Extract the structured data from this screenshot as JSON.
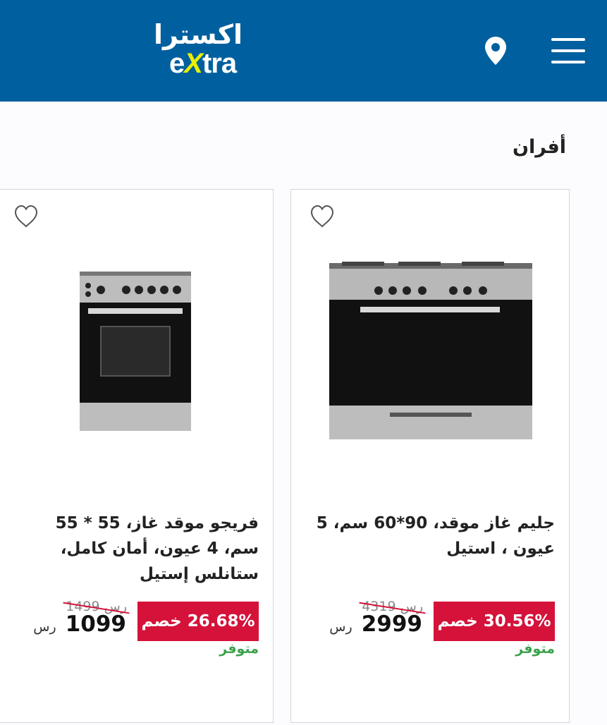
{
  "header": {
    "logo_ar": "اكسترا",
    "logo_en_pre": "e",
    "logo_en_x": "X",
    "logo_en_post": "tra",
    "brand_color": "#00609f",
    "accent_color": "#e8f000",
    "icons": [
      "location-pin-icon",
      "hamburger-menu-icon"
    ]
  },
  "section": {
    "title": "أفران"
  },
  "products": [
    {
      "title": "جليم غاز موقد، 90*60 سم، 5 عيون ، استيل",
      "discount": "30.56% خصم",
      "old_price": "4319",
      "old_currency": "رس",
      "new_price": "2999",
      "currency": "رس",
      "stock": "متوفر"
    },
    {
      "title": "فريجو موقد غاز، 55 * 55 سم، 4 عيون، أمان كامل، ستانلس إستيل",
      "discount": "26.68% خصم",
      "old_price": "1499",
      "old_currency": "رس",
      "new_price": "1099",
      "currency": "رس",
      "stock": "متوفر"
    }
  ],
  "colors": {
    "discount_bg": "#d5123a",
    "stock": "#3aa24a"
  }
}
